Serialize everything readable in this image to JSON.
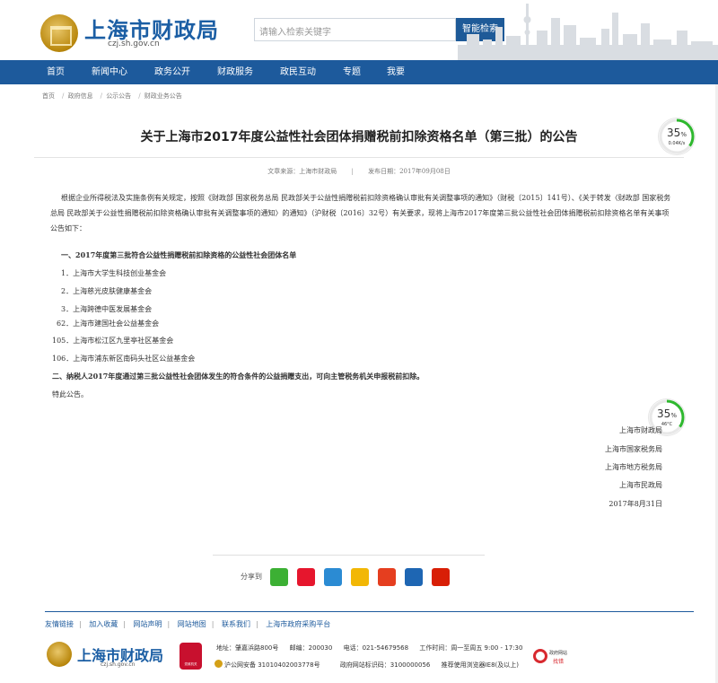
{
  "header": {
    "site_title": "上海市财政局",
    "site_domain": "czj.sh.gov.cn",
    "search_placeholder": "请输入检索关键字",
    "search_button": "智能检索"
  },
  "nav": {
    "items": [
      "首页",
      "新闻中心",
      "政务公开",
      "财政服务",
      "政民互动",
      "专题",
      "我要"
    ]
  },
  "breadcrumb": [
    "首页",
    "政府信息",
    "公示公告",
    "财政业务公告"
  ],
  "article": {
    "title": "关于上海市2017年度公益性社会团体捐赠税前扣除资格名单（第三批）的公告",
    "source_label": "文章来源：上海市财政局",
    "date_label": "发布日期：2017年09月08日",
    "intro": "根据企业所得税法及实施条例有关规定，按照《财政部 国家税务总局 民政部关于公益性捐赠税前扣除资格确认审批有关调整事项的通知》（财税〔2015〕141号）、《关于转发〈财政部 国家税务总局 民政部关于公益性捐赠税前扣除资格确认审批有关调整事项的通知〉的通知》（沪财税〔2016〕32号）有关要求，现将上海市2017年度第三批公益性社会团体捐赠税前扣除资格名单有关事项公告如下：",
    "section_1": "一、2017年度第三批符合公益性捐赠税前扣除资格的公益性社会团体名单",
    "list": [
      "1．上海市大学生科技创业基金会",
      "2．上海慈光皮肤健康基金会",
      "3．上海跨德中医发展基金会",
      "62．上海市建国社会公益基金会",
      "105．上海市松江区九里亭社区基金会",
      "106．上海市浦东新区南码头社区公益基金会"
    ],
    "section_2": "二、纳税人2017年度通过第三批公益性社会团体发生的符合条件的公益捐赠支出，可向主管税务机关申报税前扣除。",
    "closing": "特此公告。",
    "signatures": [
      "上海市财政局",
      "上海市国家税务局",
      "上海市地方税务局",
      "上海市民政局",
      "2017年8月31日"
    ]
  },
  "gauge_1": {
    "percent": "35",
    "unit": "%",
    "sub": "0.04K/s",
    "fraction": 0.35
  },
  "gauge_2": {
    "percent": "35",
    "unit": "%",
    "sub": "46°C",
    "fraction": 0.35
  },
  "share": {
    "label": "分享到",
    "icons": [
      "wechat-icon",
      "weibo-icon",
      "qzone-icon",
      "favorite-icon",
      "tencent-icon",
      "renren-icon",
      "people-icon"
    ],
    "colors": [
      "#3cb034",
      "#e6162d",
      "#2b8bd3",
      "#f2b705",
      "#e53e1f",
      "#1e66b3",
      "#d81e06"
    ]
  },
  "footer": {
    "links": [
      "友情链接",
      "加入收藏",
      "网站声明",
      "网站地图",
      "联系我们",
      "上海市政府采购平台"
    ],
    "site_title": "上海市财政局",
    "site_domain": "czj.sh.gov.cn",
    "badge_text": "党政机关",
    "address": "地址：肇嘉浜路800号",
    "postcode": "邮编：200030",
    "phone": "电话：021-54679568",
    "hours": "工作时间：周一至周五 9:00 - 17:30",
    "icp": "沪公网安备 31010402003778号",
    "site_code": "政府网站标识码：3100000056",
    "browser_note": "推荐使用浏览器IE8(及以上)",
    "err_line1": "政府网站",
    "err_line2": "找错"
  },
  "colors": {
    "brand_blue": "#1d5a9c",
    "logo_gold": "#b8860b",
    "gauge_green": "#2eb82e"
  }
}
